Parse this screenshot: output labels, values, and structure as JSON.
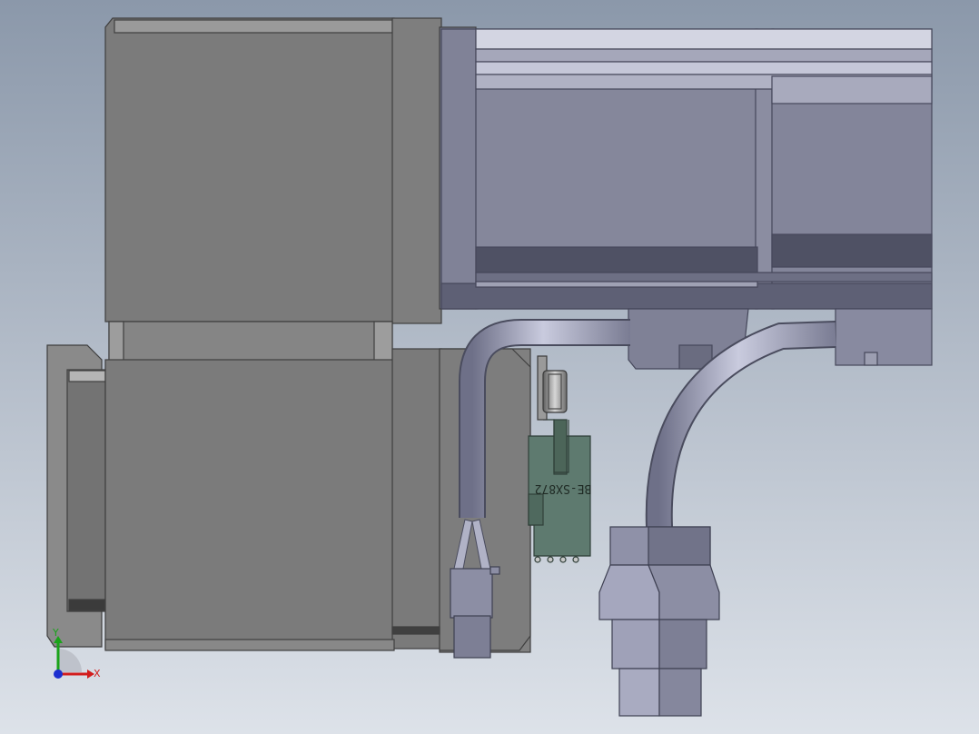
{
  "viewport": {
    "background_top": "#8b98aa",
    "background_bottom": "#dde2e9"
  },
  "colors": {
    "gear_grey": "#7b7b7b",
    "gear_edge": "#3f3f3f",
    "motor_blue": "#85879b",
    "motor_light": "#b4b6c8",
    "motor_dark": "#55576a",
    "cable": "#a7a9bf",
    "pcb_green": "#5e7a6f",
    "connector": "#8b8ca4"
  },
  "board": {
    "label": "BE-SX872"
  },
  "triad": {
    "x_label": "X",
    "y_label": "Y",
    "x_color": "#d21d1d",
    "y_color": "#1aa31a",
    "z_color": "#1c2fd0",
    "icon": "coordinate-triad-icon"
  }
}
